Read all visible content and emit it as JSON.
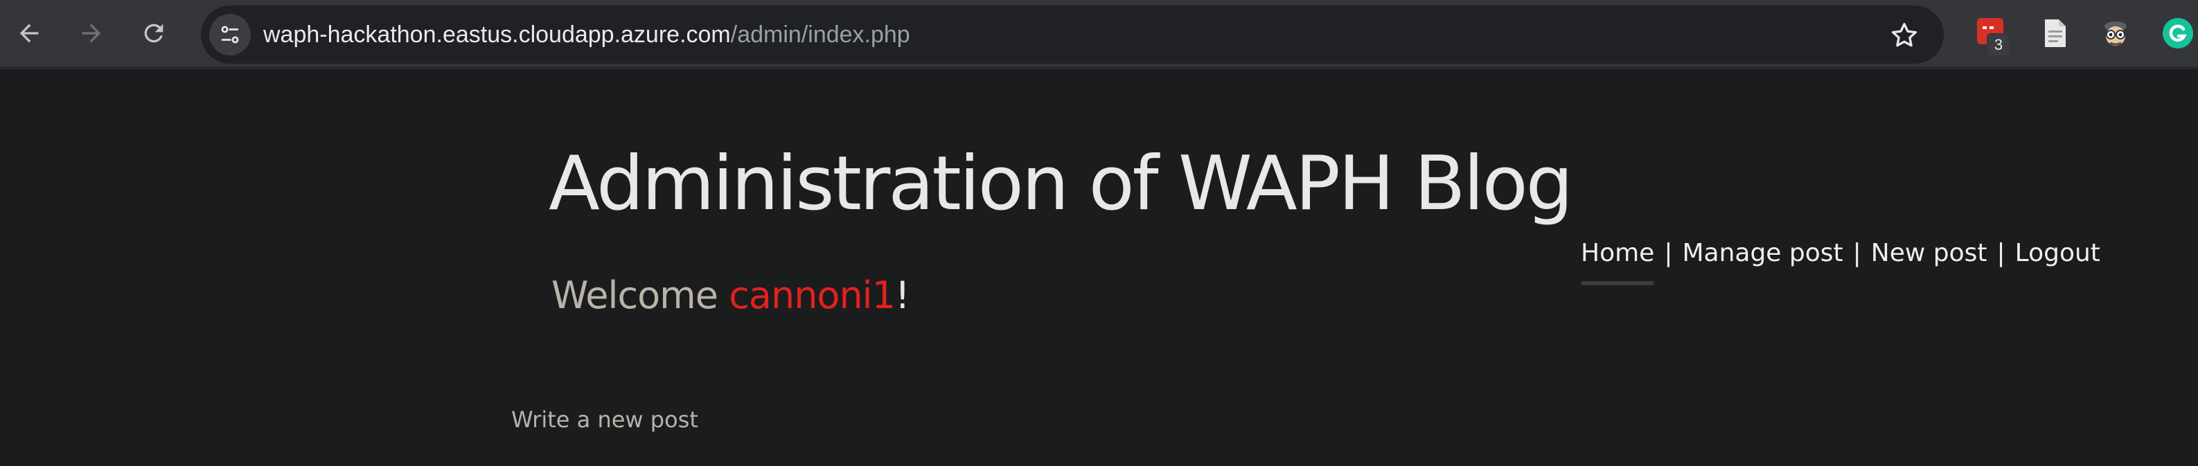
{
  "browser": {
    "url_host": "waph-hackathon.eastus.cloudapp.azure.com",
    "url_path": "/admin/index.php",
    "icons": {
      "back": "back-arrow-icon",
      "forward": "forward-arrow-icon",
      "reload": "reload-icon",
      "site_info": "tune-icon",
      "bookmark": "star-icon"
    },
    "extensions": [
      {
        "name": "red-extension-icon",
        "badge": "3"
      },
      {
        "name": "document-extension-icon"
      },
      {
        "name": "spy-extension-icon"
      },
      {
        "name": "grammarly-icon"
      }
    ]
  },
  "page": {
    "title": "Administration of WAPH Blog",
    "welcome_prefix": "Welcome ",
    "username": "cannoni1",
    "welcome_suffix": "!",
    "nav": [
      {
        "label": "Home",
        "active": true
      },
      {
        "label": "Manage post"
      },
      {
        "label": "New post"
      },
      {
        "label": "Logout"
      }
    ],
    "nav_separator": "|",
    "write_link": "Write a new post"
  },
  "colors": {
    "background": "#1b1c1e",
    "title": "#e9e8e6",
    "username": "#e3211f",
    "muted_text": "#b9b3a8"
  }
}
